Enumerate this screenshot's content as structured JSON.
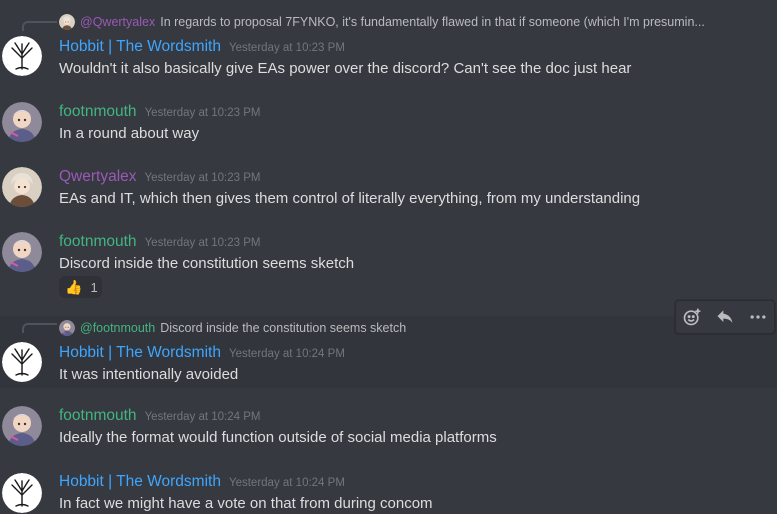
{
  "colors": {
    "hobbit": "#3ea6ff",
    "footnmouth": "#43b581",
    "qwertyalex": "#9b59b6",
    "background": "#36393f"
  },
  "messages": [
    {
      "reply": {
        "mention": "@Qwertyalex",
        "text": "In regards to proposal 7FYNKO, it's fundamentally flawed in that if someone (which I'm presumin..."
      },
      "username": "Hobbit | The Wordsmith",
      "timestamp": "Yesterday at 10:23 PM",
      "content": "Wouldn't it also basically give EAs power over the discord? Can't see the doc just hear"
    },
    {
      "username": "footnmouth",
      "timestamp": "Yesterday at 10:23 PM",
      "content": "In a round about way"
    },
    {
      "username": "Qwertyalex",
      "timestamp": "Yesterday at 10:23 PM",
      "content": "EAs and IT, which then gives them control of literally everything, from my understanding"
    },
    {
      "username": "footnmouth",
      "timestamp": "Yesterday at 10:23 PM",
      "content": "Discord inside the constitution seems sketch",
      "reaction": {
        "emoji": "👍",
        "count": "1"
      }
    },
    {
      "reply": {
        "mention": "@footnmouth",
        "text": "Discord inside the constitution seems sketch"
      },
      "username": "Hobbit | The Wordsmith",
      "timestamp": "Yesterday at 10:24 PM",
      "content": "It was intentionally avoided"
    },
    {
      "username": "footnmouth",
      "timestamp": "Yesterday at 10:24 PM",
      "content": "Ideally the format would function outside of social media platforms"
    },
    {
      "username": "Hobbit | The Wordsmith",
      "timestamp": "Yesterday at 10:24 PM",
      "content": "In fact we might have a vote on that from during concom"
    }
  ],
  "toolbar": {
    "icons": [
      "add-reaction-icon",
      "reply-icon",
      "more-icon"
    ]
  }
}
